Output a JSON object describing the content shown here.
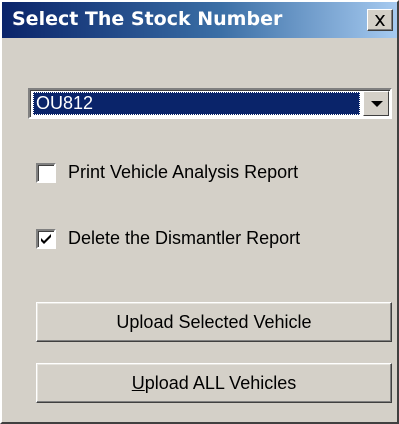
{
  "window": {
    "title": "Select The Stock Number",
    "close_glyph": "✕",
    "close_icon": "close-icon"
  },
  "stock_select": {
    "selected_value": "OU812",
    "dropdown_icon": "chevron-down-icon"
  },
  "options": {
    "print_report": {
      "label": "Print Vehicle Analysis Report",
      "checked": false
    },
    "delete_report": {
      "label": "Delete the Dismantler Report",
      "checked": true
    }
  },
  "buttons": {
    "upload_selected": {
      "label": "Upload Selected Vehicle"
    },
    "upload_all": {
      "label_mnemonic": "U",
      "label_rest": "pload ALL Vehicles"
    }
  },
  "colors": {
    "title_gradient_start": "#0a246a",
    "title_gradient_end": "#a6caf0",
    "face": "#d4d0c8",
    "selection": "#0a246a"
  }
}
